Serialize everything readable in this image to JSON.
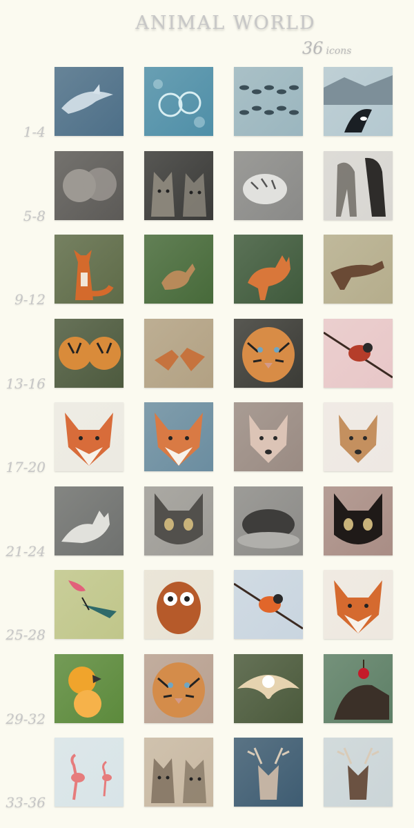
{
  "header": {
    "title": "ANIMAL WORLD",
    "count": "36",
    "count_word": "icons"
  },
  "rows": [
    {
      "label": "1-4",
      "icons": [
        {
          "name": "dolphin-icon",
          "bg": "#4d6f88",
          "fg": "#d6e2ea",
          "shape": "dolphin"
        },
        {
          "name": "jellyfish-icon",
          "bg": "#4f8fa8",
          "fg": "#d8eef2",
          "shape": "jelly"
        },
        {
          "name": "fish-school-icon",
          "bg": "#9bb6bf",
          "fg": "#3b4e57",
          "shape": "school"
        },
        {
          "name": "orca-icon",
          "bg": "#b4c8d0",
          "fg": "#1a1f24",
          "shape": "orca"
        }
      ]
    },
    {
      "label": "5-8",
      "icons": [
        {
          "name": "lion-couple-icon",
          "bg": "#5c5a57",
          "fg": "#9d9993",
          "shape": "pair"
        },
        {
          "name": "cats-icon",
          "bg": "#3a3a38",
          "fg": "#8a857a",
          "shape": "cats"
        },
        {
          "name": "tiger-cub-icon",
          "bg": "#8a8a88",
          "fg": "#e1e1de",
          "shape": "cub"
        },
        {
          "name": "leopard-icon",
          "bg": "#d8d6d2",
          "fg": "#5a554e",
          "shape": "leopard"
        }
      ]
    },
    {
      "label": "9-12",
      "icons": [
        {
          "name": "fox-sitting-icon",
          "bg": "#5e6b48",
          "fg": "#d46a2c",
          "shape": "foxsit"
        },
        {
          "name": "deer-fawn-icon",
          "bg": "#476a3a",
          "fg": "#b88a5a",
          "shape": "fawn"
        },
        {
          "name": "fox-standing-icon",
          "bg": "#3f5a3c",
          "fg": "#d9773a",
          "shape": "foxstand"
        },
        {
          "name": "fox-prowling-icon",
          "bg": "#b5ad8c",
          "fg": "#6a4a35",
          "shape": "foxlow"
        }
      ]
    },
    {
      "label": "13-16",
      "icons": [
        {
          "name": "tiger-pair-icon",
          "bg": "#4d5a3e",
          "fg": "#d98b3a",
          "shape": "tigers"
        },
        {
          "name": "fawns-icon",
          "bg": "#b2a183",
          "fg": "#c6733e",
          "shape": "fawns"
        },
        {
          "name": "tiger-face-icon",
          "bg": "#3b3b36",
          "fg": "#d88c46",
          "shape": "tigerface"
        },
        {
          "name": "robin-icon",
          "bg": "#e8c7c8",
          "fg": "#b53d2a",
          "shape": "bird"
        }
      ]
    },
    {
      "label": "17-20",
      "icons": [
        {
          "name": "fox-portrait-icon",
          "bg": "#eceae2",
          "fg": "#d86c3a",
          "shape": "foxhead"
        },
        {
          "name": "fox-face-icon",
          "bg": "#6b8da0",
          "fg": "#d97a44",
          "shape": "foxhead"
        },
        {
          "name": "husky-icon",
          "bg": "#9a8b83",
          "fg": "#dcc4b6",
          "shape": "dog"
        },
        {
          "name": "chihuahua-icon",
          "bg": "#eee8e3",
          "fg": "#c4905f",
          "shape": "dog"
        }
      ]
    },
    {
      "label": "21-24",
      "icons": [
        {
          "name": "white-wolf-icon",
          "bg": "#6f716f",
          "fg": "#e1e1dc",
          "shape": "wolf"
        },
        {
          "name": "kitten-face-icon",
          "bg": "#9d9b96",
          "fg": "#52504c",
          "shape": "catface"
        },
        {
          "name": "sleeping-cats-icon",
          "bg": "#8c8b88",
          "fg": "#3e3d3b",
          "shape": "sleep"
        },
        {
          "name": "black-cat-icon",
          "bg": "#a98d85",
          "fg": "#1f1a18",
          "shape": "catface"
        }
      ]
    },
    {
      "label": "25-28",
      "icons": [
        {
          "name": "hummingbird-icon",
          "bg": "#c0c68a",
          "fg": "#e2607a",
          "shape": "humming"
        },
        {
          "name": "owl-painting-icon",
          "bg": "#e8e2d4",
          "fg": "#b65a2a",
          "shape": "owl"
        },
        {
          "name": "flying-bird-icon",
          "bg": "#c9d5e0",
          "fg": "#e1662a",
          "shape": "bird"
        },
        {
          "name": "fox-closeup-icon",
          "bg": "#eee8e0",
          "fg": "#d56a2f",
          "shape": "foxhead"
        }
      ]
    },
    {
      "label": "29-32",
      "icons": [
        {
          "name": "parrots-icon",
          "bg": "#5c8a3c",
          "fg": "#f0a42c",
          "shape": "parrots"
        },
        {
          "name": "tiger-closeup-icon",
          "bg": "#b8a090",
          "fg": "#d48c4a",
          "shape": "tigerface"
        },
        {
          "name": "barn-owl-icon",
          "bg": "#4b5a3c",
          "fg": "#e6d3b0",
          "shape": "owlfly"
        },
        {
          "name": "dog-cherry-icon",
          "bg": "#5d7f66",
          "fg": "#3b3028",
          "shape": "dogcherry"
        }
      ]
    },
    {
      "label": "33-36",
      "icons": [
        {
          "name": "flamingos-icon",
          "bg": "#d8e4e8",
          "fg": "#e67c7c",
          "shape": "flamingo"
        },
        {
          "name": "surprised-cats-icon",
          "bg": "#c8b8a2",
          "fg": "#8b7c6a",
          "shape": "cats"
        },
        {
          "name": "stag-icon",
          "bg": "#3e5c72",
          "fg": "#c4b4a4",
          "shape": "stag"
        },
        {
          "name": "deer-fight-icon",
          "bg": "#cbd5d8",
          "fg": "#6b5242",
          "shape": "stag"
        }
      ]
    }
  ]
}
